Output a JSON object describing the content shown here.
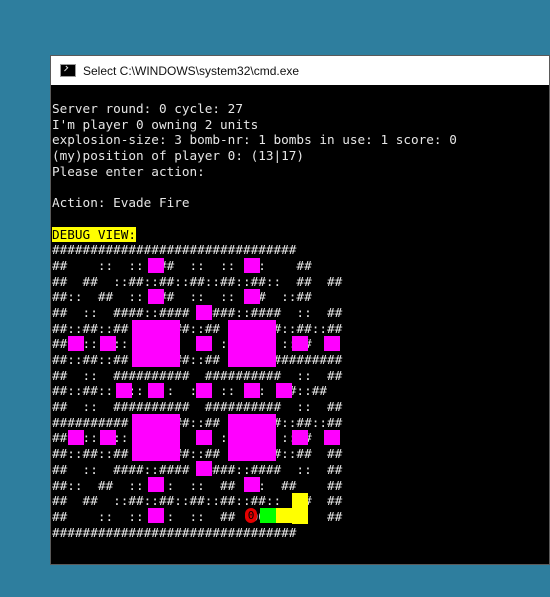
{
  "window": {
    "title": "Select C:\\WINDOWS\\system32\\cmd.exe",
    "icon": "cmd-icon"
  },
  "console": {
    "lines": [
      "Server round: 0 cycle: 27",
      "I'm player 0 owning 2 units",
      "explosion-size: 3 bomb-nr: 1 bombs in use: 1 score: 0",
      "(my)position of player 0: (13|17)",
      "Please enter action:",
      "",
      "Action: Evade Fire",
      ""
    ],
    "debug_label": "DEBUG VIEW:",
    "map": [
      "################################",
      "##    ::  ::  ##  ::  ::  ::    ##",
      "##  ##  ::##::##::##::##::##::  ##  ##",
      "##::  ##  ::  ##  ::  ::  ##  ::##",
      "##  ::  ####::####  ####::####  ::  ##",
      "##::##::##      ##::##      ##::##::##",
      "##  ::  ::            ::  ::  ::##",
      "##::##::##      ##::##      ##########",
      "##  ::  ##########  ##########  ::  ##",
      "##::##::  ::  ::  ::  ::  ::  ##::##",
      "##  ::  ##########  ##########  ::  ##",
      "##########      ##::##      ##::##::##",
      "##  ::  ::            ::  ::  ::##",
      "##::##::##      ##::##      ##::##  ##",
      "##  ::  ####::####  ####::####  ::  ##",
      "##::  ##  ::  ::  ::  ##  ::  ##    ##",
      "##  ##  ::##::##::##::##::##::  ##  ##",
      "##    ::  ::  ::  ::  ##  00        ##",
      "################################"
    ],
    "player_marker": "0",
    "unit_marker": "00",
    "colors": {
      "background": "#000000",
      "text": "#e6e6e6",
      "explosion": "#ff00ff",
      "danger": "#ffff00",
      "unit": "#00ff00",
      "player": "#e40000"
    }
  }
}
